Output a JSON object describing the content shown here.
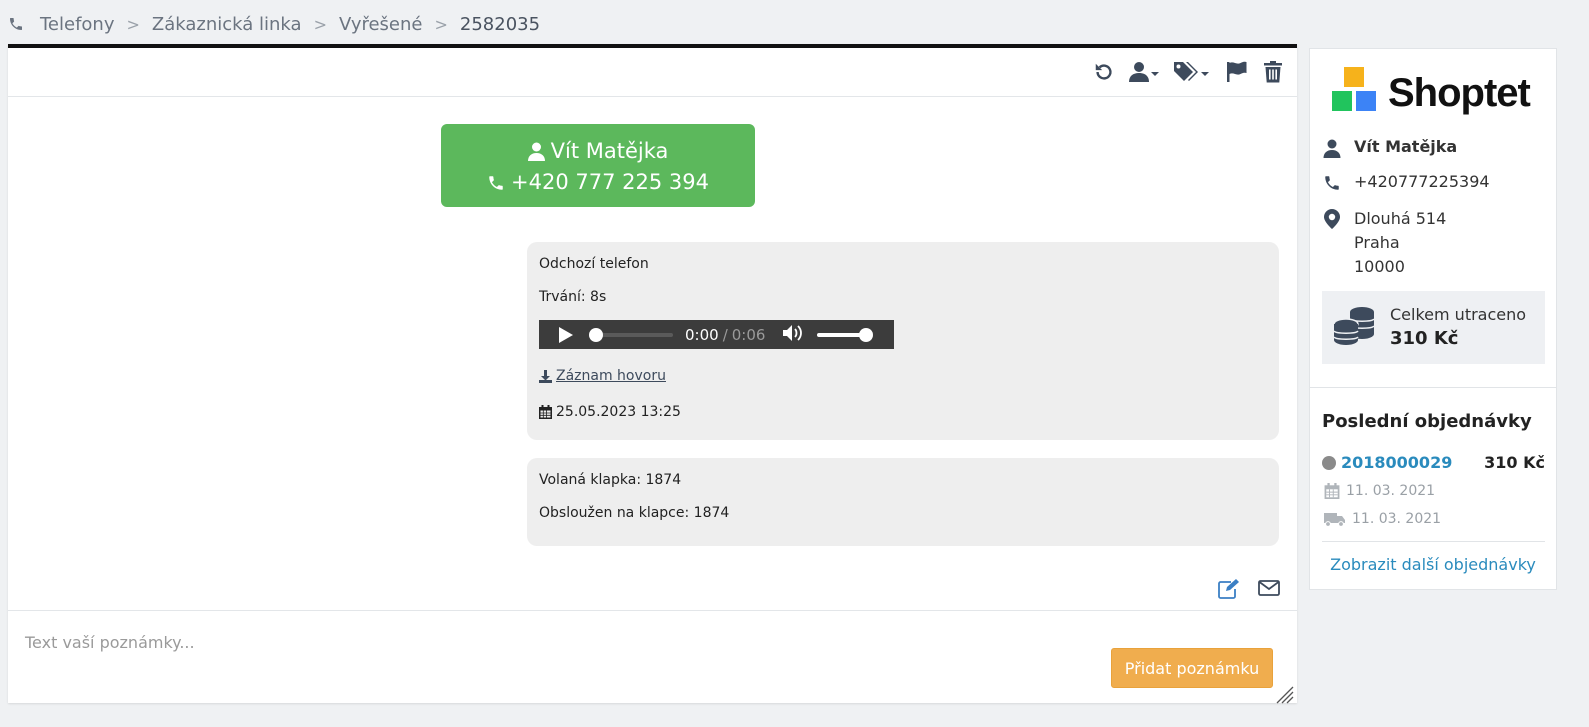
{
  "breadcrumb": {
    "items": [
      "Telefony",
      "Zákaznická linka",
      "Vyřešené"
    ],
    "separator": ">",
    "current": "2582035"
  },
  "toolbar": {
    "icons": [
      "undo-icon",
      "assign-user-icon",
      "tags-icon",
      "flag-icon",
      "trash-icon"
    ]
  },
  "contact": {
    "name": "Vít Matějka",
    "phone": "+420 777 225 394",
    "color": "#5cb85c"
  },
  "messages": {
    "call": {
      "type": "Odchozí telefon",
      "duration": "Trvání: 8s",
      "audio": {
        "current": "0:00",
        "separator": "/",
        "total": "0:06"
      },
      "recording_link": "Záznam hovoru",
      "datetime": "25.05.2023 13:25"
    },
    "routing": {
      "called_ext": "Volaná klapka: 1874",
      "served_ext": "Obsloužen na klapce: 1874"
    }
  },
  "note": {
    "placeholder": "Text vaší poznámky...",
    "submit_label": "Přidat poznámku",
    "button_color": "#f0ad4e"
  },
  "sidebar": {
    "brand": "Shoptet",
    "customer": {
      "name": "Vít Matějka",
      "phone": "+420777225394",
      "street": "Dlouhá 514",
      "city": "Praha",
      "zip": "10000"
    },
    "spent": {
      "label": "Celkem utraceno",
      "value": "310 Kč"
    },
    "orders": {
      "title": "Poslední objednávky",
      "items": [
        {
          "id": "2018000029",
          "price": "310 Kč",
          "created": "11. 03. 2021",
          "shipped": "11. 03. 2021"
        }
      ],
      "more_link": "Zobrazit další objednávky"
    },
    "link_color": "#2a8bbd"
  }
}
